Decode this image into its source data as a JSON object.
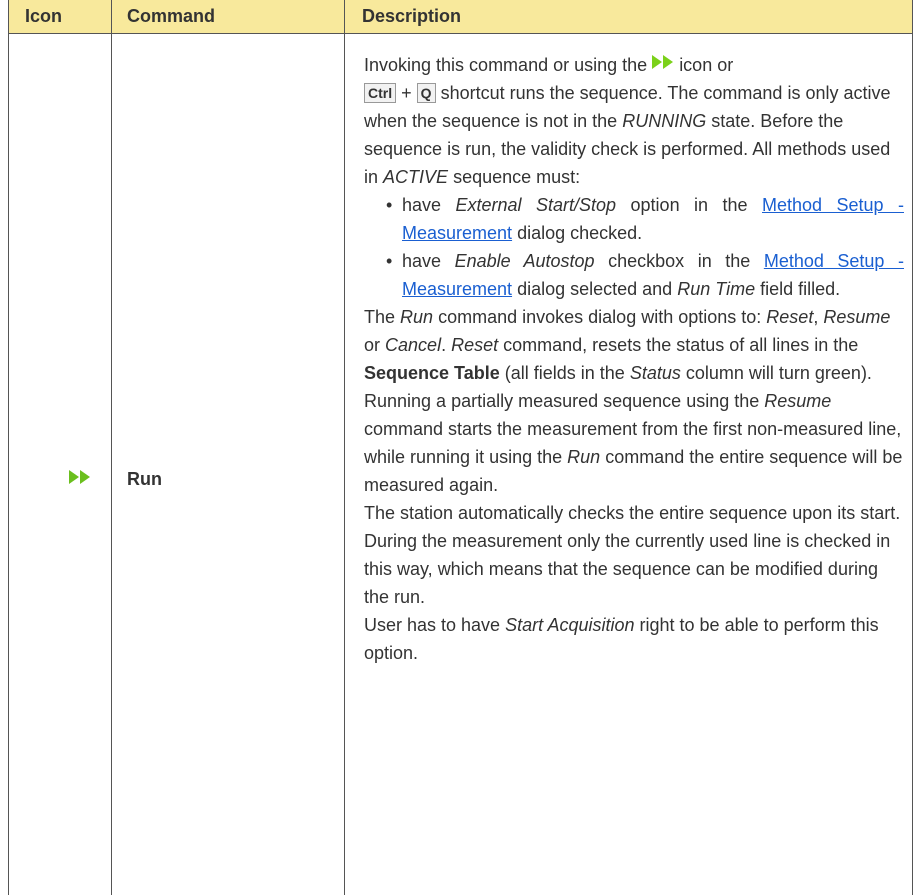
{
  "header": {
    "col_icon": "Icon",
    "col_command": "Command",
    "col_description": "Description"
  },
  "row": {
    "icon_name": "run-icon",
    "command": "Run",
    "desc": {
      "p1_a": "Invoking this command or using the",
      "p1_b": "icon or",
      "key_ctrl": "Ctrl",
      "plus": "+",
      "key_q": "Q",
      "p1_c": "shortcut runs the sequence. The command is only active when the sequence is not in the",
      "running": "RUNNING",
      "p1_d": "state. Before the sequence is run, the validity check is performed. All methods used in",
      "active": "ACTIVE",
      "p1_e": "sequence must:",
      "b1_a": "have",
      "b1_opt": "External Start/Stop",
      "b1_b": "option in the",
      "b1_c": "dialog checked.",
      "link": "Method Setup - Measurement",
      "b2_a": "have",
      "b2_opt": "Enable Autostop",
      "b2_b": "checkbox in the",
      "b2_c": "dialog selected and",
      "b2_runtime": "Run Time",
      "b2_d": "field filled.",
      "p2_a": "The",
      "p2_run": "Run",
      "p2_b": "command invokes dialog with options to:",
      "p2_reset": "Reset",
      "p2_c": ",",
      "p2_resume": "Resume",
      "p2_d": "or",
      "p2_cancel": "Cancel",
      "p2_e": ".",
      "p2_reset2": "Reset",
      "p2_f": "command, resets the status of all lines in the",
      "p2_table": "Sequence Table",
      "p2_g": "(all fields in the",
      "p2_status": "Status",
      "p2_h": "column will turn green).",
      "p3_a": "Running a partially measured sequence using the",
      "p3_resume": "Resume",
      "p3_b": "command starts the measurement from the first non-measured line, while running it using the",
      "p3_run": "Run",
      "p3_c": "command the entire sequence will be measured again.",
      "p4": "The station automatically checks the entire sequence upon its start. During the measurement only the currently used line is checked in this way, which means that the sequence can be modified during the run.",
      "p5_a": "User has to have",
      "p5_right": "Start Acquisition",
      "p5_b": "right to be able to perform this option."
    }
  },
  "colors": {
    "header_bg": "#f8e99c",
    "link": "#1a5fd1",
    "icon_green": "#6bbf1e"
  }
}
